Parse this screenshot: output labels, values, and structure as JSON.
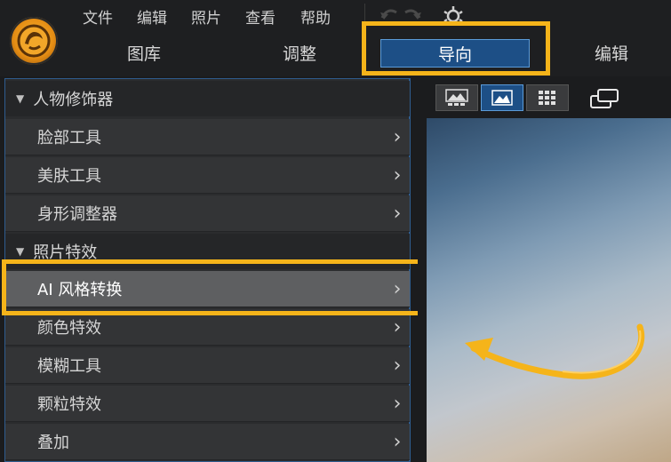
{
  "menu": {
    "items": [
      "文件",
      "编辑",
      "照片",
      "查看",
      "帮助"
    ]
  },
  "modes": {
    "tabs": [
      "图库",
      "调整",
      "导向",
      "编辑"
    ],
    "active": "导向"
  },
  "view_buttons": [
    "compare-view-icon",
    "single-view-icon",
    "grid-view-icon"
  ],
  "sidebar": {
    "sections": [
      {
        "title": "人物修饰器",
        "items": [
          "脸部工具",
          "美肤工具",
          "身形调整器"
        ]
      },
      {
        "title": "照片特效",
        "items": [
          "AI 风格转换",
          "颜色特效",
          "模糊工具",
          "颗粒特效",
          "叠加"
        ]
      }
    ],
    "selected": "AI 风格转换"
  },
  "colors": {
    "highlight": "#f5b41a",
    "active_tab": "#1d4f86",
    "accent_border": "#5b9bd8"
  }
}
